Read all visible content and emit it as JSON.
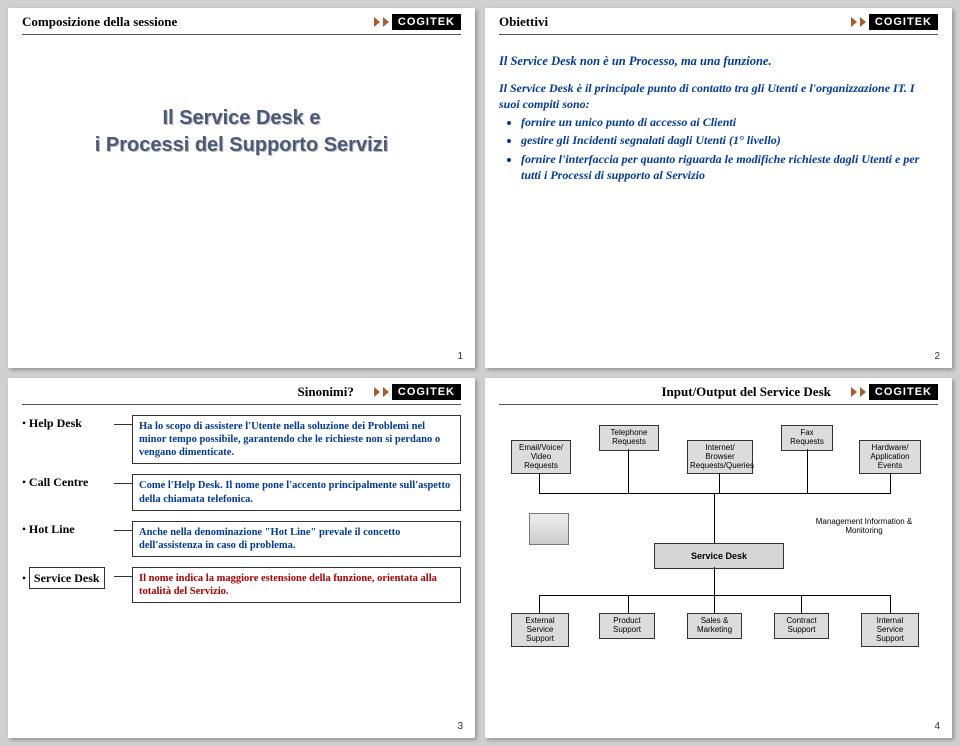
{
  "brand": "COGITEK",
  "slides": {
    "s1": {
      "header": "Composizione della sessione",
      "title_line1": "Il Service Desk e",
      "title_line2": "i Processi del Supporto Servizi",
      "number": "1"
    },
    "s2": {
      "header": "Obiettivi",
      "intro": "Il Service Desk non è un Processo, ma una funzione.",
      "body_line1": "Il Service Desk è il principale punto di contatto tra gli Utenti e l'organizzazione IT. I suoi compiti sono:",
      "bullets": [
        "fornire un unico punto di accesso ai Clienti",
        "gestire gli Incidenti segnalati dagli Utenti (1° livello)",
        "fornire l'interfaccia per quanto riguarda le modifiche richieste dagli Utenti e per tutti i Processi di supporto al Servizio"
      ],
      "number": "2"
    },
    "s3": {
      "header": "Sinonimi?",
      "rows": [
        {
          "label": "Help Desk",
          "desc": "Ha lo scopo di assistere l'Utente nella soluzione dei Problemi nel minor tempo possibile, garantendo che le richieste non si perdano o vengano dimenticate.",
          "color": "blue"
        },
        {
          "label": "Call Centre",
          "desc": "Come l'Help Desk. Il nome pone l'accento principalmente sull'aspetto della chiamata telefonica.",
          "color": "blue"
        },
        {
          "label": "Hot Line",
          "desc": "Anche nella denominazione \"Hot Line\" prevale il concetto dell'assistenza in caso di problema.",
          "color": "blue"
        },
        {
          "label": "Service Desk",
          "desc": "Il nome indica la maggiore estensione della funzione, orientata alla totalità del Servizio.",
          "color": "red",
          "boxed": true
        }
      ],
      "number": "3"
    },
    "s4": {
      "header": "Input/Output del Service Desk",
      "top_inputs": [
        "Email/Voice/ Video Requests",
        "Telephone Requests",
        "Internet/ Browser Requests/Queries",
        "Fax Requests",
        "Hardware/ Application Events"
      ],
      "center_right": "Management Information & Monitoring",
      "service_desk": "Service Desk",
      "bottom_outputs": [
        "External Service Support",
        "Product Support",
        "Sales & Marketing",
        "Contract Support",
        "Internal Service Support"
      ],
      "number": "4"
    }
  }
}
